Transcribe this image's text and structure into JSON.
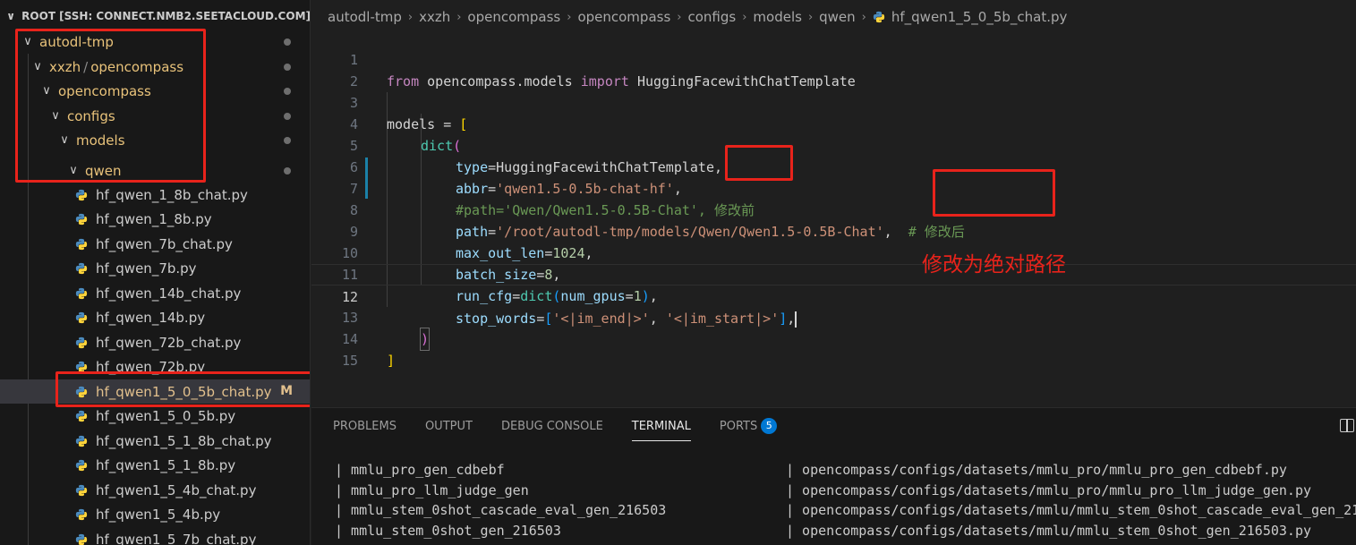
{
  "explorer": {
    "root_label": "ROOT [SSH: CONNECT.NMB2.SEETACLOUD.COM]",
    "folders": [
      {
        "name": "autodl-tmp"
      },
      {
        "name": "xxzh",
        "name2": "opencompass"
      },
      {
        "name": "opencompass"
      },
      {
        "name": "configs"
      },
      {
        "name": "models"
      },
      {
        "name": "qwen"
      }
    ],
    "files": [
      "hf_qwen_1_8b_chat.py",
      "hf_qwen_1_8b.py",
      "hf_qwen_7b_chat.py",
      "hf_qwen_7b.py",
      "hf_qwen_14b_chat.py",
      "hf_qwen_14b.py",
      "hf_qwen_72b_chat.py",
      "hf_qwen_72b.py",
      "hf_qwen1_5_0_5b_chat.py",
      "hf_qwen1_5_0_5b.py",
      "hf_qwen1_5_1_8b_chat.py",
      "hf_qwen1_5_1_8b.py",
      "hf_qwen1_5_4b_chat.py",
      "hf_qwen1_5_4b.py",
      "hf_qwen1_5_7b_chat.py"
    ],
    "active_file_badge": "M"
  },
  "breadcrumb": [
    "autodl-tmp",
    "xxzh",
    "opencompass",
    "opencompass",
    "configs",
    "models",
    "qwen",
    "hf_qwen1_5_0_5b_chat.py"
  ],
  "editor": {
    "line_numbers": [
      "1",
      "2",
      "3",
      "4",
      "5",
      "6",
      "7",
      "8",
      "9",
      "10",
      "11",
      "12",
      "13",
      "14",
      "15"
    ],
    "l1": {
      "kw1": "from",
      "mod": " opencompass.models ",
      "kw2": "import",
      "cls": " HuggingFacewithChatTemplate"
    },
    "l3": {
      "var": "models",
      "op": " = ",
      "br": "["
    },
    "l4": {
      "fn": "dict",
      "br": "("
    },
    "l5": {
      "key": "type",
      "op": "=",
      "val": "HuggingFacewithChatTemplate",
      "tail": ","
    },
    "l6": {
      "key": "abbr",
      "op": "=",
      "str": "'qwen1.5-0.5b-chat-hf'",
      "tail": ","
    },
    "l7": {
      "comment": "#path='Qwen/Qwen1.5-0.5B-Chat', 修改前"
    },
    "l8": {
      "key": "path",
      "op": "=",
      "str": "'/root/autodl-tmp/models/Qwen/Qwen1.5-0.5B-Chat'",
      "tail": ",  ",
      "comment": "# 修改后"
    },
    "l9": {
      "key": "max_out_len",
      "op": "=",
      "num": "1024",
      "tail": ","
    },
    "l10": {
      "key": "batch_size",
      "op": "=",
      "num": "8",
      "tail": ","
    },
    "l11": {
      "key": "run_cfg",
      "op": "=",
      "fn": "dict",
      "br_open": "(",
      "arg": "num_gpus",
      "op2": "=",
      "num": "1",
      "br_close": ")",
      "tail": ","
    },
    "l12": {
      "key": "stop_words",
      "op": "=",
      "br_open": "[",
      "s1": "'<|im_end|>'",
      "comma": ", ",
      "s2": "'<|im_start|>'",
      "br_close": "]",
      "tail": ","
    },
    "l13": {
      "br": ")"
    },
    "l14": {
      "br": "]"
    }
  },
  "annotation_text": "修改为绝对路径",
  "panel": {
    "tabs": [
      "PROBLEMS",
      "OUTPUT",
      "DEBUG CONSOLE",
      "TERMINAL",
      "PORTS"
    ],
    "ports_count": "5",
    "active_tab": "TERMINAL",
    "terminal_rows": [
      {
        "name": "| mmlu_pro_gen_cdbebf",
        "path": "| opencompass/configs/datasets/mmlu_pro/mmlu_pro_gen_cdbebf.py"
      },
      {
        "name": "| mmlu_pro_llm_judge_gen",
        "path": "| opencompass/configs/datasets/mmlu_pro/mmlu_pro_llm_judge_gen.py"
      },
      {
        "name": "| mmlu_stem_0shot_cascade_eval_gen_216503",
        "path": "| opencompass/configs/datasets/mmlu/mmlu_stem_0shot_cascade_eval_gen_21"
      },
      {
        "name": "| mmlu_stem_0shot_gen_216503",
        "path": "| opencompass/configs/datasets/mmlu/mmlu_stem_0shot_gen_216503.py"
      }
    ]
  }
}
